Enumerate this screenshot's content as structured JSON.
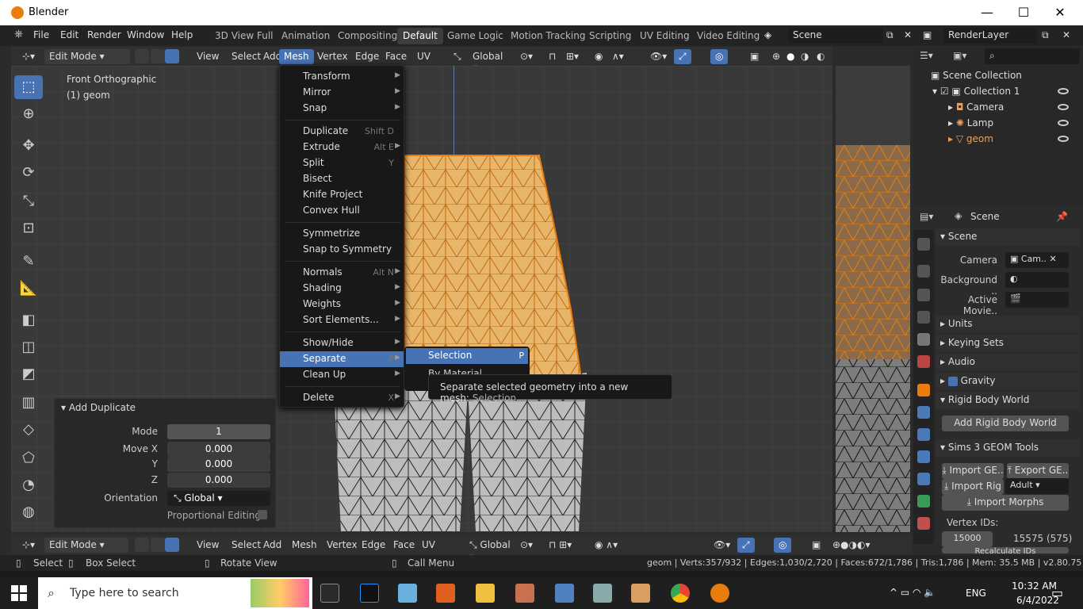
{
  "window": {
    "title": "Blender",
    "controls": [
      "—",
      "☐",
      "✕"
    ]
  },
  "topmenu": {
    "items": [
      "File",
      "Edit",
      "Render",
      "Window",
      "Help"
    ]
  },
  "workspaces": [
    "3D View Full",
    "Animation",
    "Compositing",
    "Default",
    "Game Logic",
    "Motion Tracking",
    "Scripting",
    "UV Editing",
    "Video Editing"
  ],
  "active_workspace": "Default",
  "scene_field": "Scene",
  "renderlayer_field": "RenderLayer",
  "viewport_header": {
    "mode": "Edit Mode",
    "menus": [
      "View",
      "Select",
      "Add",
      "Mesh",
      "Vertex",
      "Edge",
      "Face",
      "UV"
    ],
    "orientation": "Global"
  },
  "viewport": {
    "view_name": "Front Orthographic",
    "object_label": "(1) geom"
  },
  "mesh_menu": {
    "items": [
      {
        "label": "Transform",
        "shortcut": "",
        "submenu": true
      },
      {
        "label": "Mirror",
        "shortcut": "",
        "submenu": true
      },
      {
        "label": "Snap",
        "shortcut": "",
        "submenu": true
      },
      {
        "label": "Duplicate",
        "shortcut": "Shift D",
        "submenu": false
      },
      {
        "label": "Extrude",
        "shortcut": "Alt E",
        "submenu": true
      },
      {
        "label": "Split",
        "shortcut": "Y",
        "submenu": false
      },
      {
        "label": "Bisect",
        "shortcut": "",
        "submenu": false
      },
      {
        "label": "Knife Project",
        "shortcut": "",
        "submenu": false
      },
      {
        "label": "Convex Hull",
        "shortcut": "",
        "submenu": false
      },
      {
        "label": "Symmetrize",
        "shortcut": "",
        "submenu": false
      },
      {
        "label": "Snap to Symmetry",
        "shortcut": "",
        "submenu": false
      },
      {
        "label": "Normals",
        "shortcut": "Alt N",
        "submenu": true
      },
      {
        "label": "Shading",
        "shortcut": "",
        "submenu": true
      },
      {
        "label": "Weights",
        "shortcut": "",
        "submenu": true
      },
      {
        "label": "Sort Elements...",
        "shortcut": "",
        "submenu": true
      },
      {
        "label": "Show/Hide",
        "shortcut": "",
        "submenu": true
      },
      {
        "label": "Separate",
        "shortcut": "P",
        "submenu": true
      },
      {
        "label": "Clean Up",
        "shortcut": "",
        "submenu": true
      },
      {
        "label": "Delete",
        "shortcut": "X",
        "submenu": true
      }
    ]
  },
  "separate_submenu": {
    "items": [
      {
        "label": "Selection",
        "shortcut": "P"
      },
      {
        "label": "By Material",
        "shortcut": ""
      }
    ]
  },
  "tooltip": {
    "text": "Separate selected geometry into a new mesh:",
    "python": "Selection"
  },
  "redo_panel": {
    "title": "Add Duplicate",
    "fields": [
      {
        "label": "Mode",
        "value": "1"
      },
      {
        "label": "Move X",
        "value": "0.000"
      },
      {
        "label": "Y",
        "value": "0.000"
      },
      {
        "label": "Z",
        "value": "0.000"
      }
    ],
    "orientation_label": "Orientation",
    "orientation_value": "Global",
    "proportional_label": "Proportional Editing"
  },
  "outliner": {
    "root": "Scene Collection",
    "collection": "Collection 1",
    "objects": [
      "Camera",
      "Lamp",
      "geom"
    ]
  },
  "properties": {
    "context": "Scene",
    "section_scene": "Scene",
    "camera_label": "Camera",
    "camera_value": "Cam..",
    "background_label": "Background ..",
    "active_movie_label": "Active Movie..",
    "collapsed": [
      "Units",
      "Keying Sets",
      "Audio"
    ],
    "gravity": "Gravity",
    "rigid_body": "Rigid Body World",
    "add_rigid": "Add Rigid Body World",
    "sims_panel": "Sims 3 GEOM Tools",
    "import_geom": "Import GE..",
    "export_geom": "Export GE..",
    "import_rig": "Import Rig",
    "rig_value": "Adult",
    "import_morphs": "Import Morphs",
    "vertex_ids_label": "Vertex IDs:",
    "vertex_id_start": "15000",
    "vertex_id_end": "15575 (575)",
    "recalc": "Recalculate IDs"
  },
  "bottom_header": {
    "mode": "Edit Mode",
    "menus": [
      "View",
      "Select",
      "Add",
      "Mesh",
      "Vertex",
      "Edge",
      "Face",
      "UV"
    ],
    "orientation": "Global"
  },
  "statusbar": {
    "select": "Select",
    "box_select": "Box Select",
    "rotate": "Rotate View",
    "call_menu": "Call Menu",
    "stats": "geom | Verts:357/932 | Edges:1,030/2,720 | Faces:672/1,786 | Tris:1,786 | Mem: 35.5 MB | v2.80.75"
  },
  "taskbar": {
    "search_placeholder": "Type here to search",
    "lang": "ENG",
    "time": "10:32 AM",
    "date": "6/4/2022"
  },
  "colors": {
    "accent": "#4772b3",
    "mesh_selected": "#e8b66b",
    "mesh_edge": "#e87d0d",
    "blender_orange": "#e87d0d"
  }
}
